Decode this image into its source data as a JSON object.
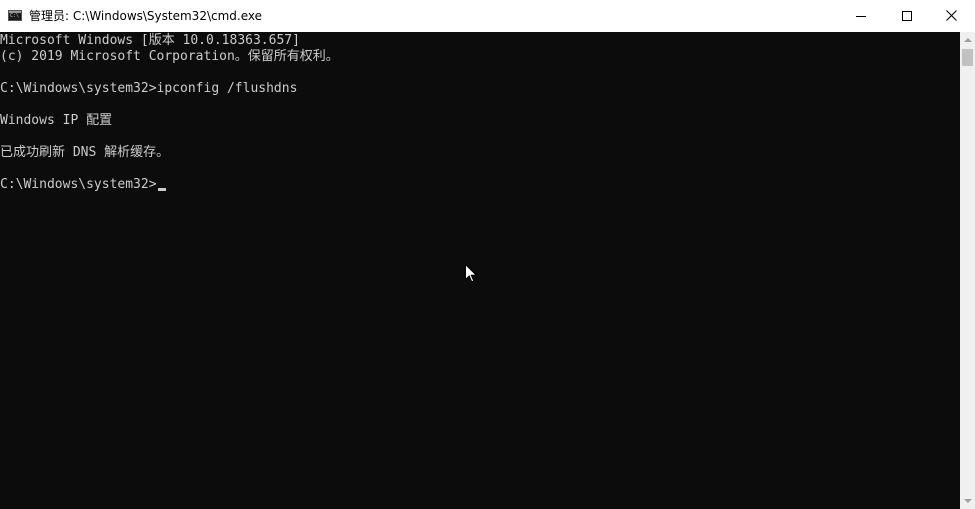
{
  "window": {
    "title": "管理员: C:\\Windows\\System32\\cmd.exe",
    "icon": "cmd-icon",
    "controls": {
      "minimize": "minimize-icon",
      "maximize": "maximize-icon",
      "close": "close-icon"
    }
  },
  "console": {
    "foreground": "#cccccc",
    "background": "#0c0c0c",
    "lines": [
      "Microsoft Windows [版本 10.0.18363.657]",
      "(c) 2019 Microsoft Corporation。保留所有权利。",
      "",
      "C:\\Windows\\system32>ipconfig /flushdns",
      "",
      "Windows IP 配置",
      "",
      "已成功刷新 DNS 解析缓存。",
      "",
      "C:\\Windows\\system32>"
    ],
    "cursor": "underscore-cursor"
  },
  "scrollbar": {
    "up_icon": "scroll-up-arrow-icon",
    "down_icon": "scroll-down-arrow-icon"
  },
  "pointer": "mouse-pointer-icon"
}
